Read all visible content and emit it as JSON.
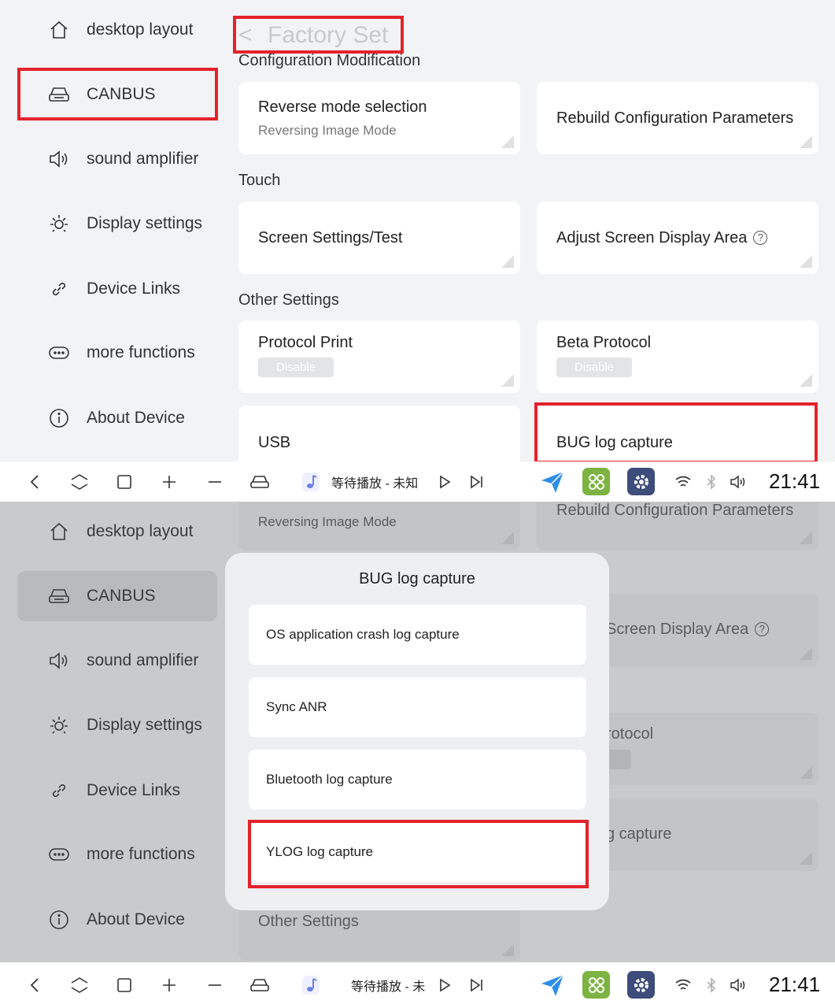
{
  "sidebar": {
    "items": [
      {
        "label": "desktop layout",
        "icon": "home-icon"
      },
      {
        "label": "CANBUS",
        "icon": "car-icon"
      },
      {
        "label": "sound amplifier",
        "icon": "speaker-icon"
      },
      {
        "label": "Display settings",
        "icon": "brightness-icon"
      },
      {
        "label": "Device Links",
        "icon": "link-icon"
      },
      {
        "label": "more functions",
        "icon": "more-icon"
      },
      {
        "label": "About Device",
        "icon": "info-icon"
      }
    ]
  },
  "header": {
    "back_glyph": "<",
    "title": "Factory Set"
  },
  "sections": {
    "config": "Configuration Modification",
    "touch": "Touch",
    "other": "Other Settings"
  },
  "cards": {
    "reverse_title": "Reverse mode selection",
    "reverse_value": "Reversing Image Mode",
    "rebuild": "Rebuild Configuration Parameters",
    "screen_settings": "Screen Settings/Test",
    "adjust_display": "Adjust Screen Display Area",
    "help_glyph": "?",
    "protocol_print": "Protocol Print",
    "protocol_print_state": "Disable",
    "beta_protocol": "Beta Protocol",
    "beta_protocol_state": "Disable",
    "usb": "USB",
    "bug_log": "BUG log capture"
  },
  "navbar": {
    "media_text_top": "等待播放 - 未知",
    "media_text_bottom": "等待播放 - 未",
    "time": "21:41"
  },
  "dialog": {
    "title": "BUG log capture",
    "options": [
      "OS application crash log capture",
      "Sync ANR",
      "Bluetooth log capture",
      "YLOG log capture"
    ]
  },
  "background_fragments": {
    "adjust_partial": "Screen Display Area",
    "beta_partial": "rotocol",
    "bug_partial": "g capture"
  },
  "colors": {
    "highlight": "#e3232b",
    "overlay": "#c9cacc"
  }
}
